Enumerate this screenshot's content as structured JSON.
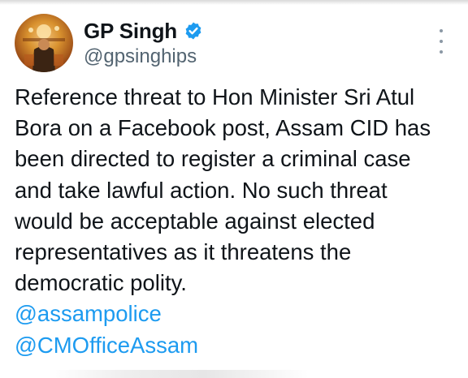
{
  "author": {
    "display_name": "GP Singh",
    "handle": "@gpsinghips",
    "verified": true,
    "avatar_icon": "profile-photo",
    "verified_icon": "verified-badge-icon"
  },
  "menu": {
    "icon": "more-options-icon"
  },
  "tweet": {
    "lines": [
      "Reference threat to Hon Minister Sri Atul",
      "Bora on a Facebook post, Assam CID has",
      "been directed to register a criminal case",
      "and take lawful action. No such threat",
      "would be acceptable against elected",
      "representatives as it threatens the",
      "democratic polity."
    ],
    "mentions": [
      "@assampolice",
      "@CMOfficeAssam"
    ]
  },
  "colors": {
    "text": "#0f1419",
    "secondary": "#536471",
    "link": "#1d9bf0",
    "verified": "#1d9bf0"
  }
}
